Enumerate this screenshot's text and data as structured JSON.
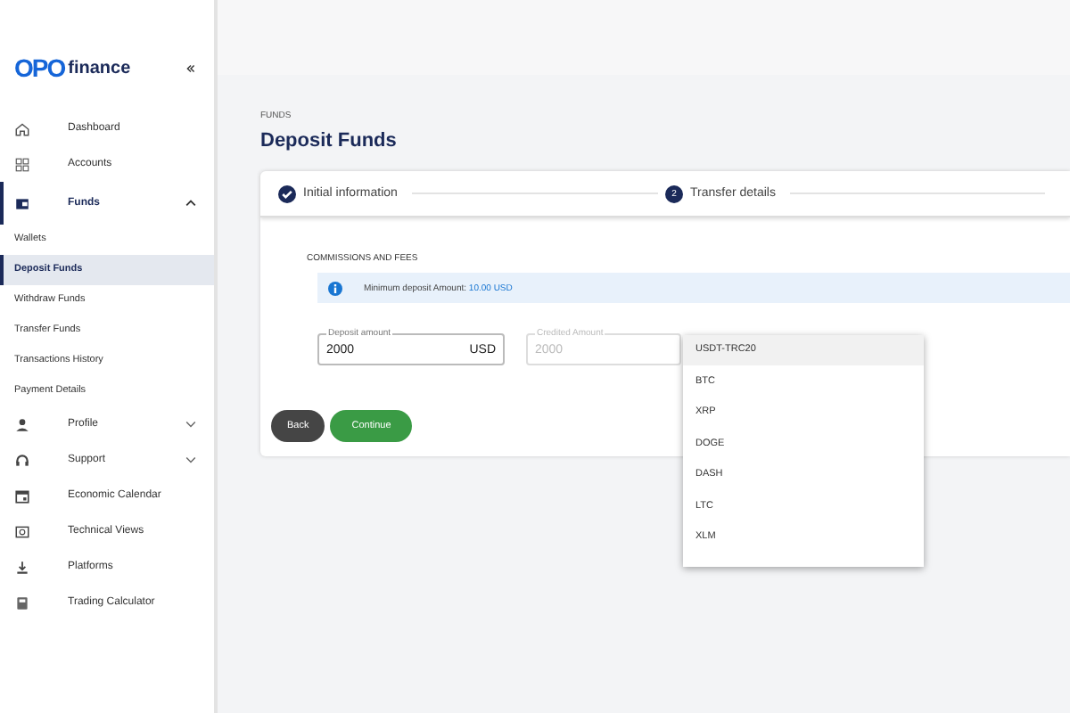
{
  "logo": {
    "mark": "OPO",
    "text": "finance"
  },
  "sidebar": {
    "items": [
      {
        "label": "Dashboard",
        "active": false
      },
      {
        "label": "Accounts",
        "active": false
      },
      {
        "label": "Funds",
        "expanded": true,
        "active": true,
        "children": [
          {
            "label": "Wallets",
            "selected": false
          },
          {
            "label": "Deposit Funds",
            "selected": true
          },
          {
            "label": "Withdraw Funds",
            "selected": false
          },
          {
            "label": "Transfer Funds",
            "selected": false
          },
          {
            "label": "Transactions History",
            "selected": false
          },
          {
            "label": "Payment Details",
            "selected": false
          }
        ]
      },
      {
        "label": "Profile",
        "expanded": false,
        "active": false
      },
      {
        "label": "Support",
        "expanded": false,
        "active": false
      },
      {
        "label": "Economic Calendar",
        "active": false
      },
      {
        "label": "Technical Views",
        "active": false
      },
      {
        "label": "Platforms",
        "active": false
      },
      {
        "label": "Trading Calculator",
        "active": false
      }
    ]
  },
  "breadcrumb": "FUNDS",
  "title": "Deposit Funds",
  "steps": [
    {
      "label": "Initial information",
      "completed": true
    },
    {
      "number": "2",
      "label": "Transfer details",
      "completed": false
    }
  ],
  "section_title": "COMMISSIONS AND FEES",
  "notice": {
    "text": "Minimum deposit Amount:",
    "amount": "10.00 USD"
  },
  "fields": [
    {
      "label": "Deposit amount",
      "value": "2000",
      "suffix": "USD",
      "disabled": false
    },
    {
      "label": "Credited Amount",
      "value": "2000",
      "disabled": true
    }
  ],
  "dropdown": {
    "options": [
      {
        "label": "USDT-TRC20",
        "selected": true
      },
      {
        "label": "BTC",
        "selected": false
      },
      {
        "label": "XRP",
        "selected": false
      },
      {
        "label": "DOGE",
        "selected": false
      },
      {
        "label": "DASH",
        "selected": false
      },
      {
        "label": "LTC",
        "selected": false
      },
      {
        "label": "XLM",
        "selected": false
      }
    ]
  },
  "buttons": [
    {
      "label": "Back",
      "kind": "secondary"
    },
    {
      "label": "Continue",
      "kind": "primary"
    }
  ]
}
